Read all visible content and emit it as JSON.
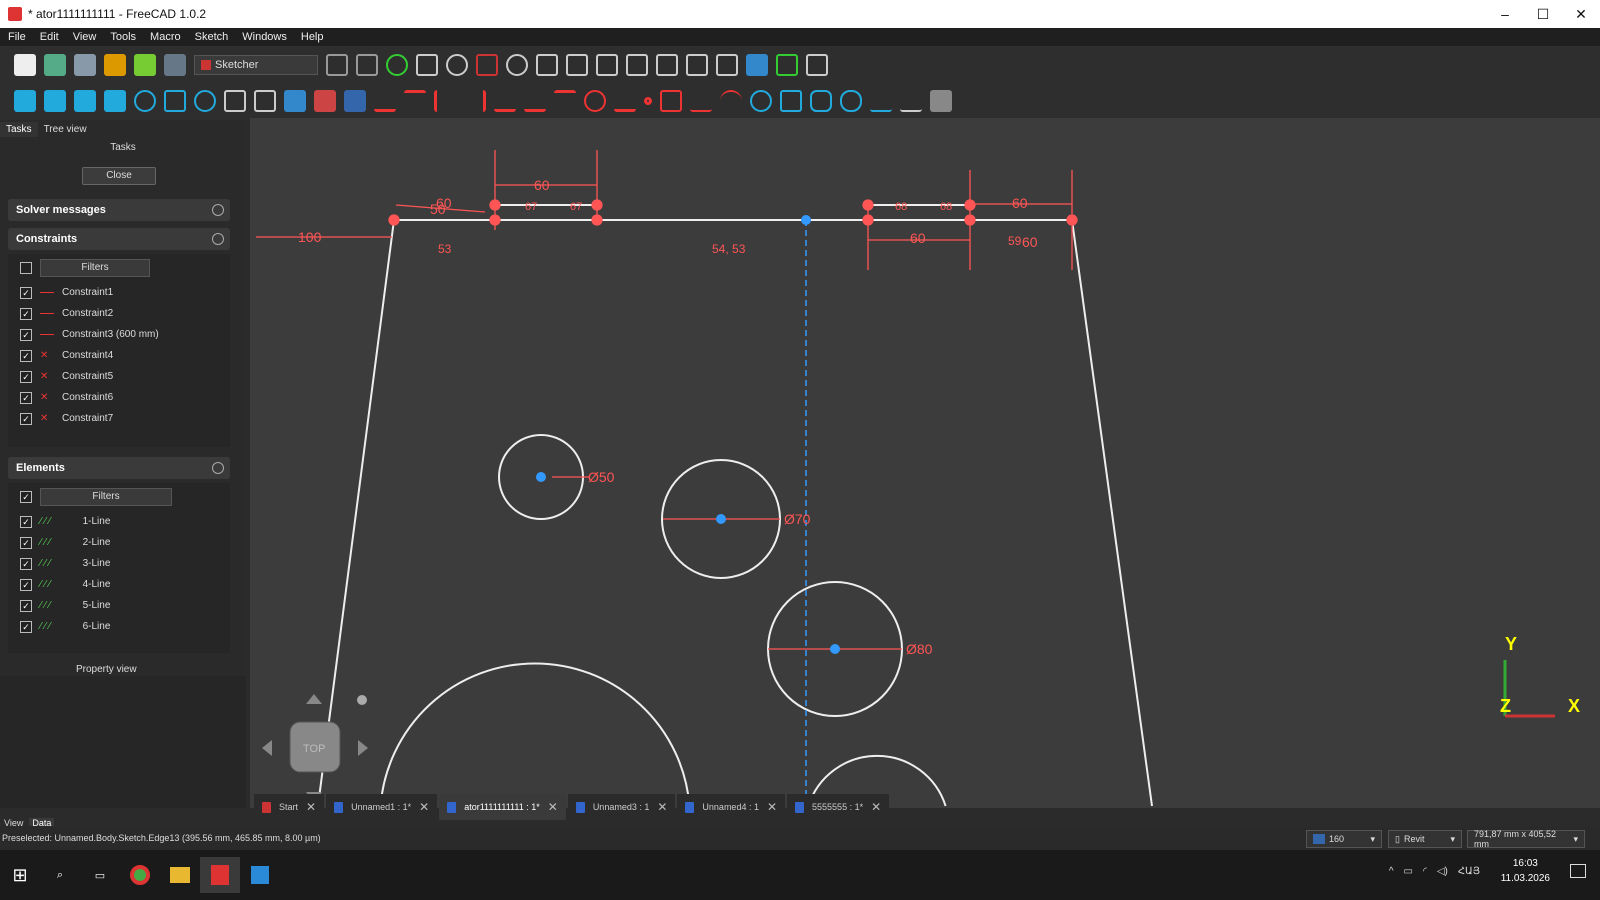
{
  "window": {
    "title": "* ator1111111111 - FreeCAD 1.0.2"
  },
  "menu": [
    "File",
    "Edit",
    "View",
    "Tools",
    "Macro",
    "Sketch",
    "Windows",
    "Help"
  ],
  "toolbar": {
    "workbench": "Sketcher"
  },
  "combo": {
    "tabs": [
      "Tasks",
      "Tree view"
    ],
    "tasks_title": "Tasks",
    "close_label": "Close",
    "solver_title": "Solver messages",
    "constraints_title": "Constraints",
    "filters_label": "Filters",
    "constraints": [
      "Constraint1",
      "Constraint2",
      "Constraint3 (600 mm)",
      "Constraint4",
      "Constraint5",
      "Constraint6",
      "Constraint7"
    ],
    "elements_title": "Elements",
    "elements": [
      "1-Line",
      "2-Line",
      "3-Line",
      "4-Line",
      "5-Line",
      "6-Line"
    ],
    "property_view": "Property view",
    "prop_tabs": [
      "View",
      "Data"
    ]
  },
  "sketch": {
    "dims": [
      "100",
      "60",
      "50",
      "60",
      "60",
      "60",
      "60",
      "Ø50",
      "Ø70",
      "Ø80"
    ],
    "labels": [
      "53",
      "54, 53",
      "59"
    ],
    "sub": [
      "67",
      "67",
      "68",
      "68"
    ],
    "nav": "TOP",
    "axes": [
      "X",
      "Y",
      "Z"
    ]
  },
  "colors": {
    "constraint": "#ff5555",
    "accent": "#3399ff"
  },
  "doc_tabs": [
    {
      "label": "Start"
    },
    {
      "label": "Unnamed1 : 1*"
    },
    {
      "label": "ator1111111111 : 1*",
      "active": true
    },
    {
      "label": "Unnamed3 : 1"
    },
    {
      "label": "Unnamed4 : 1"
    },
    {
      "label": "5555555 : 1*"
    }
  ],
  "status": {
    "text": "Preselected: Unnamed.Body.Sketch.Edge13 (395.56 mm, 465.85 mm, 8.00 µm)",
    "draw_style": "160",
    "nav_style": "Revit",
    "dimensions": "791,87 mm x 405,52 mm"
  },
  "taskbar": {
    "lang": "ՀԱՅ",
    "time": "16:03",
    "date": "11.03.2026"
  }
}
